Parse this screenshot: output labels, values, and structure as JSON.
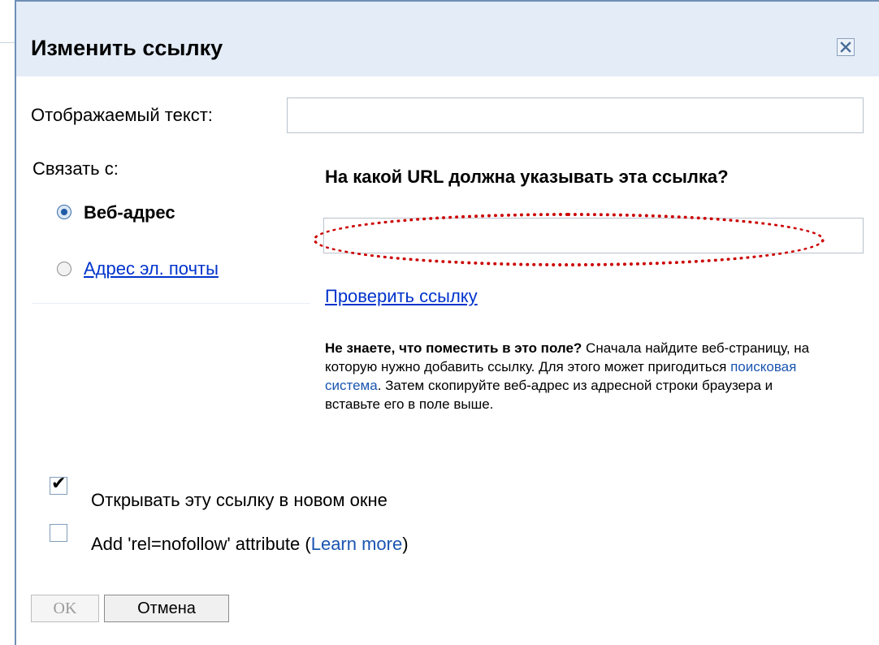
{
  "dialog": {
    "title": "Изменить ссылку",
    "close_icon": "close-icon"
  },
  "display_text": {
    "label": "Отображаемый текст:",
    "value": ""
  },
  "link_to": {
    "label": "Связать с:",
    "options": [
      {
        "label": "Веб-адрес",
        "selected": true
      },
      {
        "label": "Адрес эл. почты",
        "selected": false
      }
    ]
  },
  "url_section": {
    "heading": "На какой URL должна указывать эта ссылка?",
    "value": "",
    "test_link": "Проверить ссылку"
  },
  "help": {
    "bold": "Не знаете, что поместить в это поле?",
    "text1": " Сначала найдите веб-страницу, на которую нужно добавить ссылку. Для этого может пригодиться ",
    "link": "поисковая система",
    "text2": ". Затем скопируйте веб-адрес из адресной строки браузера и вставьте его в поле выше."
  },
  "options": {
    "new_window": {
      "label": "Открывать эту ссылку в новом окне",
      "checked": true
    },
    "nofollow": {
      "label_prefix": "Add 'rel=nofollow' attribute (",
      "link": "Learn more",
      "label_suffix": ")",
      "checked": false
    }
  },
  "buttons": {
    "ok": "OK",
    "cancel": "Отмена"
  },
  "colors": {
    "title_bar": "#e3ecf7",
    "annotation": "#cc0000",
    "link": "#0033cc"
  }
}
